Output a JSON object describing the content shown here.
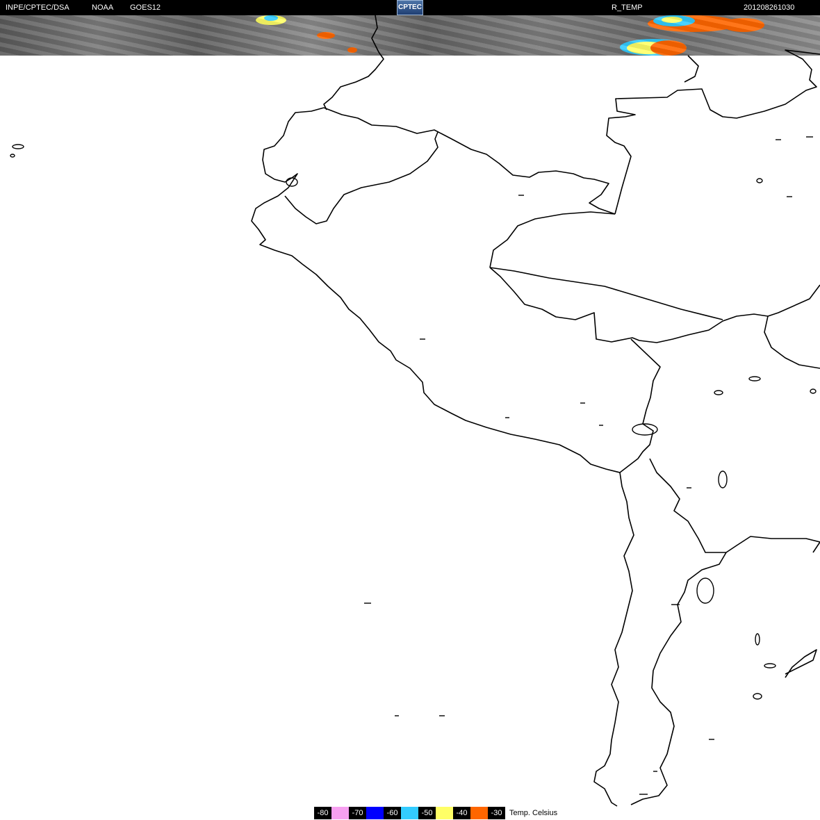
{
  "header": {
    "org": "INPE/CPTEC/DSA",
    "agency": "NOAA",
    "satellite": "GOES12",
    "product": "R_TEMP",
    "timestamp": "201208261030",
    "logo_text": "CPTEC"
  },
  "legend": {
    "unit_label": "Temp. Celsius",
    "items": [
      {
        "label": "-80",
        "color": "#f7a0f0"
      },
      {
        "label": "-70",
        "color": "#0000ff"
      },
      {
        "label": "-60",
        "color": "#33ccff"
      },
      {
        "label": "-50",
        "color": "#ffff66"
      },
      {
        "label": "-40",
        "color": "#ff6600"
      },
      {
        "label": "-30",
        "color": "#000000"
      }
    ]
  },
  "colors": {
    "background": "#ffffff",
    "coastline": "#000000",
    "header_bg": "#000000"
  }
}
